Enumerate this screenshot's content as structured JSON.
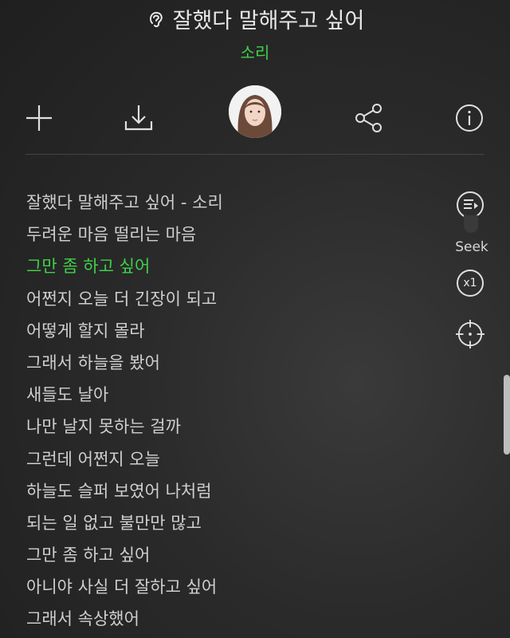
{
  "header": {
    "title": "잘했다 말해주고 싶어",
    "artist": "소리",
    "title_icon": "hearing-icon"
  },
  "toolbar": {
    "items": [
      "plus-icon",
      "download-icon",
      "avatar",
      "share-icon",
      "info-icon"
    ]
  },
  "lyrics": {
    "lines": [
      "잘했다 말해주고 싶어 - 소리",
      "두려운 마음 떨리는 마음",
      "그만 좀 하고 싶어",
      "어쩐지 오늘 더 긴장이 되고",
      "어떻게 할지 몰라",
      "그래서 하늘을 봤어",
      "새들도 날아",
      "나만 날지 못하는 걸까",
      "그런데 어쩐지 오늘",
      "하늘도 슬퍼 보였어 나처럼",
      "되는 일 없고 불만만 많고",
      "그만 좀 하고 싶어",
      "아니야 사실 더 잘하고 싶어",
      "그래서 속상했어"
    ],
    "active_index": 2
  },
  "side_controls": {
    "seek_label": "Seek",
    "speed_label": "x1"
  },
  "colors": {
    "accent": "#3fd04a",
    "background": "#2a2a2a",
    "text": "#cfcfcf"
  }
}
